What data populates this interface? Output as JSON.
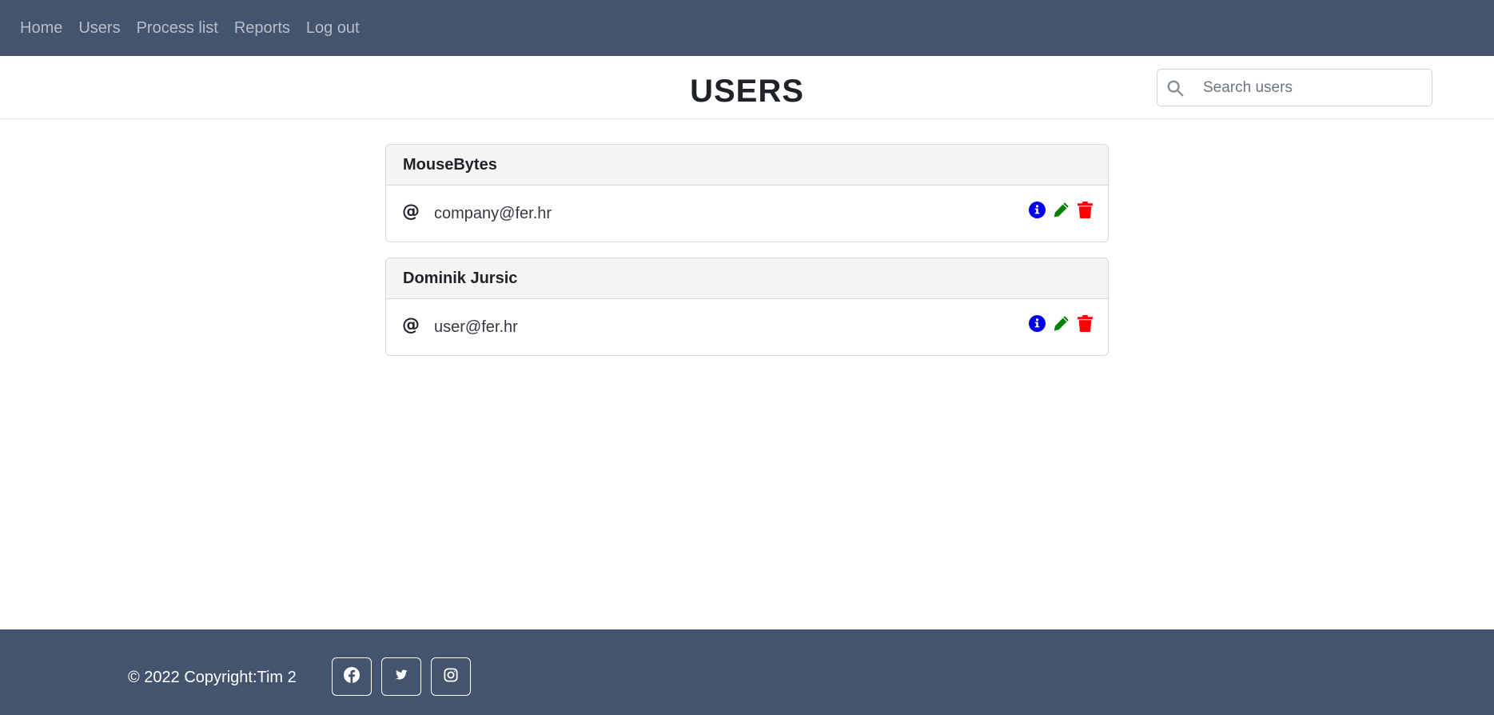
{
  "nav": {
    "items": [
      {
        "label": "Home"
      },
      {
        "label": "Users"
      },
      {
        "label": "Process list"
      },
      {
        "label": "Reports"
      },
      {
        "label": "Log out"
      }
    ]
  },
  "header": {
    "title": "USERS",
    "search": {
      "placeholder": "Search users",
      "value": "",
      "icon": "search-icon"
    }
  },
  "users": [
    {
      "name": "MouseBytes",
      "email": "company@fer.hr",
      "email_icon": "at-icon"
    },
    {
      "name": "Dominik Jursic",
      "email": "user@fer.hr",
      "email_icon": "at-icon"
    }
  ],
  "actions": {
    "info_icon": "info-icon",
    "info_color": "#0000ee",
    "edit_icon": "pencil-icon",
    "edit_color": "#008000",
    "delete_icon": "trash-icon",
    "delete_color": "#ff0000"
  },
  "footer": {
    "copyright": "© 2022 Copyright:Tim 2",
    "social": [
      "facebook-icon",
      "twitter-icon",
      "instagram-icon"
    ]
  },
  "colors": {
    "navbar_bg": "#44536e",
    "footer_bg": "#44536e"
  }
}
